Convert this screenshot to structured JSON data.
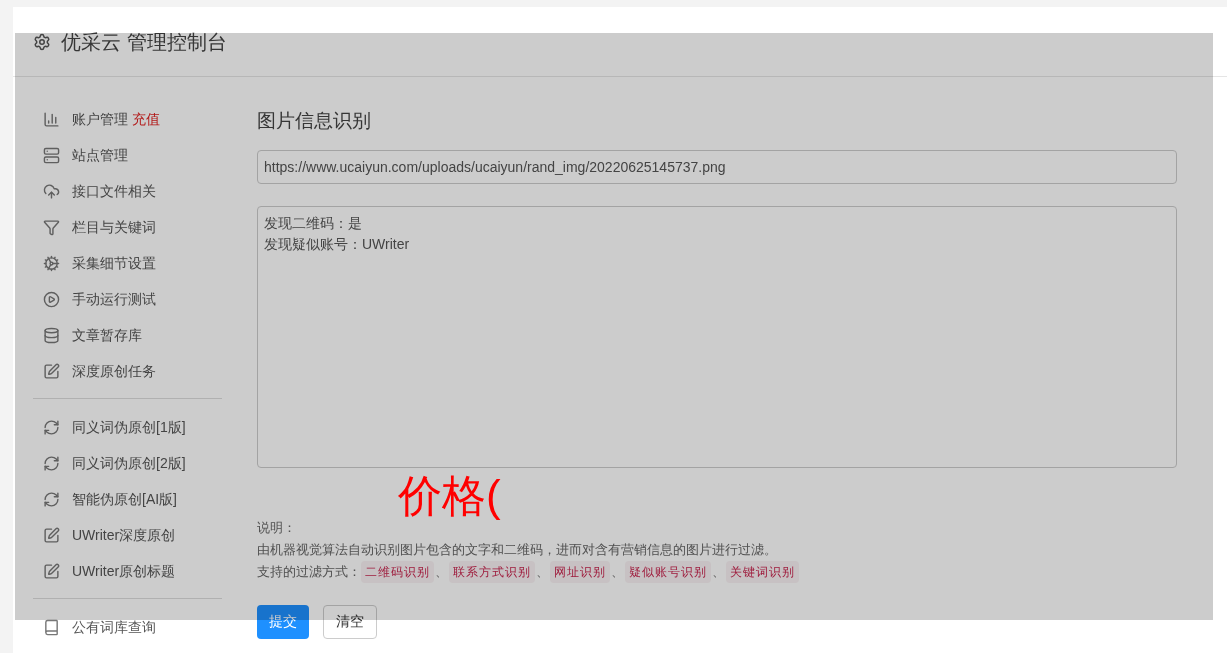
{
  "header": {
    "title": "优采云 管理控制台"
  },
  "sidebar": {
    "groups": [
      {
        "items": [
          {
            "kind": "chart",
            "label": "账户管理",
            "badge": "充值"
          },
          {
            "kind": "server",
            "label": "站点管理"
          },
          {
            "kind": "cloud",
            "label": "接口文件相关"
          },
          {
            "kind": "filter",
            "label": "栏目与关键词"
          },
          {
            "kind": "gears",
            "label": "采集细节设置"
          },
          {
            "kind": "play",
            "label": "手动运行测试"
          },
          {
            "kind": "database",
            "label": "文章暂存库"
          },
          {
            "kind": "edit",
            "label": "深度原创任务"
          }
        ]
      },
      {
        "items": [
          {
            "kind": "refresh",
            "label": "同义词伪原创[1版]"
          },
          {
            "kind": "refresh",
            "label": "同义词伪原创[2版]"
          },
          {
            "kind": "refresh",
            "label": "智能伪原创[AI版]"
          },
          {
            "kind": "edit",
            "label": "UWriter深度原创"
          },
          {
            "kind": "edit",
            "label": "UWriter原创标题"
          }
        ]
      },
      {
        "items": [
          {
            "kind": "book",
            "label": "公有词库查询"
          }
        ]
      }
    ]
  },
  "main": {
    "title": "图片信息识别",
    "url_field": {
      "value": "https://www.ucaiyun.com/uploads/ucaiyun/rand_img/20220625145737.png"
    },
    "result_lines": [
      "发现二维码：是",
      "发现疑似账号：UWriter"
    ],
    "note_label": "说明：",
    "description": "由机器视觉算法自动识别图片包含的文字和二维码，进而对含有营销信息的图片进行过滤。",
    "filters_label": "支持的过滤方式：",
    "filters": [
      "二维码识别",
      "联系方式识别",
      "网址识别",
      "疑似账号识别",
      "关键词识别"
    ],
    "separator": "、",
    "buttons": [
      {
        "kind": "primary",
        "label": "提交"
      },
      {
        "kind": "default",
        "label": "清空"
      }
    ]
  },
  "overlay": {
    "text": "价格("
  }
}
